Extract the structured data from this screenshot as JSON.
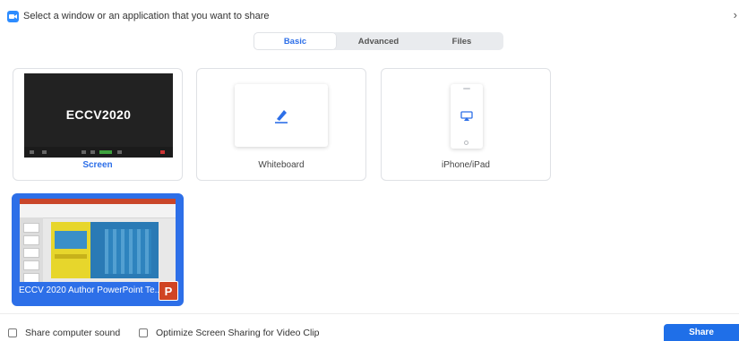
{
  "header": {
    "title": "Select a window or an application that you want to share",
    "close_glyph": "›"
  },
  "tabs": [
    {
      "label": "Basic",
      "active": true
    },
    {
      "label": "Advanced",
      "active": false
    },
    {
      "label": "Files",
      "active": false
    }
  ],
  "sources": {
    "screen": {
      "label": "Screen",
      "thumb_text": "ECCV2020"
    },
    "whiteboard": {
      "label": "Whiteboard"
    },
    "iphone": {
      "label": "iPhone/iPad"
    },
    "ppt": {
      "label": "ECCV 2020 Author PowerPoint Te...",
      "icon_letter": "P"
    }
  },
  "footer": {
    "share_sound": "Share computer sound",
    "optimize": "Optimize Screen Sharing for Video Clip",
    "share_button": "Share"
  },
  "colors": {
    "accent": "#2d6fe8",
    "share_button": "#1f6fe8",
    "ppt_red": "#d04423"
  }
}
